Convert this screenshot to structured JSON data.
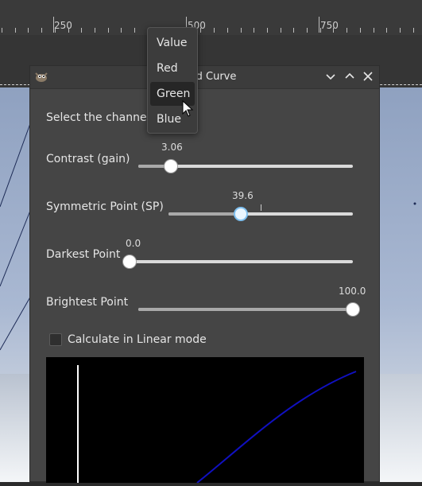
{
  "ruler": {
    "labels": [
      "250",
      "500",
      "750"
    ]
  },
  "dialog": {
    "title": "id Curve",
    "channel_label": "Select the channel:",
    "sliders": [
      {
        "label": "Contrast (gain)",
        "value": "3.06",
        "fraction": 0.15
      },
      {
        "label": "Symmetric Point (SP)",
        "value": "39.6",
        "fraction": 0.396
      },
      {
        "label": "Darkest Point",
        "value": "0.0",
        "fraction": 0.0
      },
      {
        "label": "Brightest Point",
        "value": "100.0",
        "fraction": 1.0
      }
    ],
    "linear_mode_label": "Calculate in Linear mode",
    "linear_mode_checked": false
  },
  "channel_menu": {
    "options": [
      "Value",
      "Red",
      "Green",
      "Blue"
    ],
    "highlighted": "Green"
  },
  "icons": {
    "app": "gimp-icon",
    "minimize": "chevron-down-icon",
    "maximize": "chevron-up-icon",
    "close": "close-icon",
    "cursor": "mouse-pointer-icon"
  },
  "colors": {
    "dialog_bg": "#454545",
    "curve_bg": "#000000",
    "curve_line": "#1010c0",
    "focus_ring": "#7ec0f0"
  }
}
